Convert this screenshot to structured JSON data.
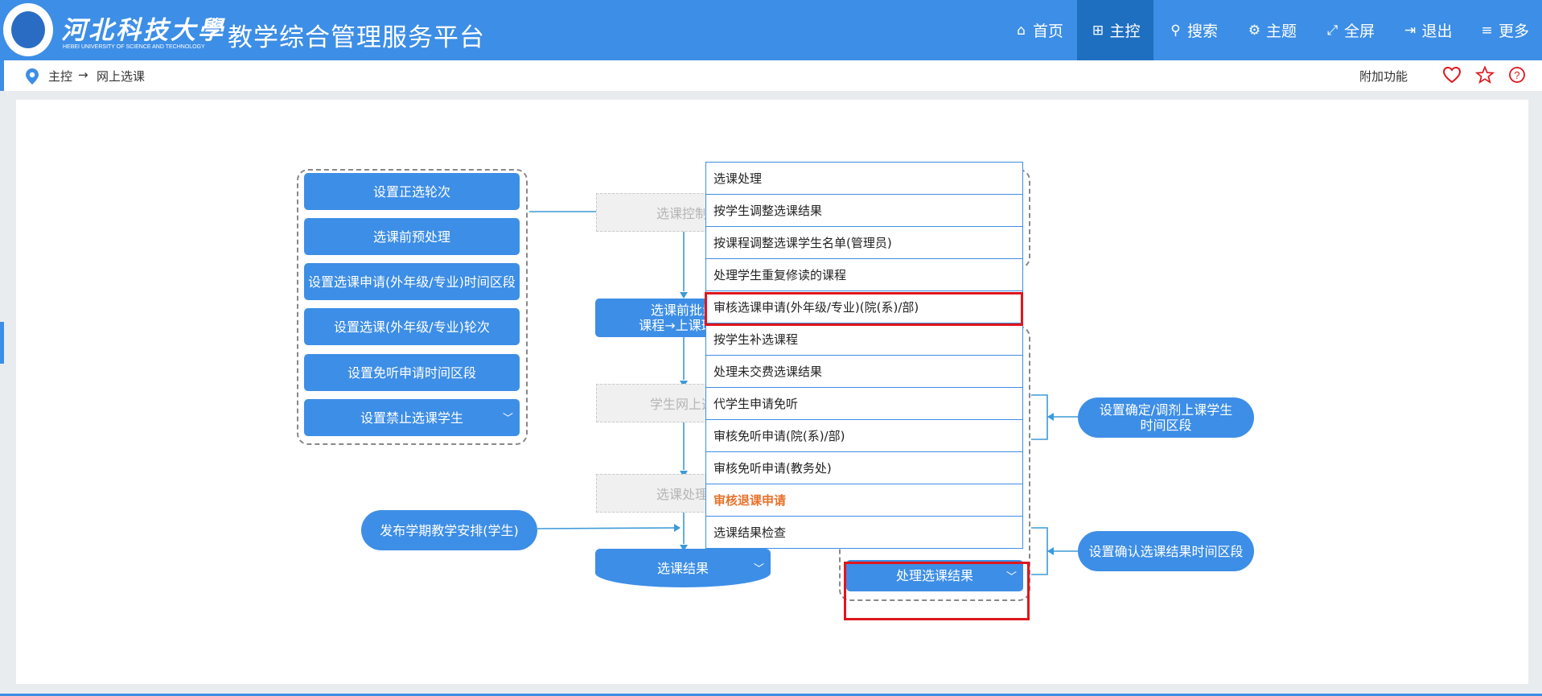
{
  "header": {
    "logo_cn": "河北科技大學",
    "logo_en": "HEBEI UNIVERSITY OF SCIENCE AND TECHNOLOGY",
    "title": "教学综合管理服务平台",
    "nav": [
      {
        "label": "首页",
        "icon": "home-icon"
      },
      {
        "label": "主控",
        "icon": "windows-icon",
        "active": true
      },
      {
        "label": "搜索",
        "icon": "search-icon"
      },
      {
        "label": "主题",
        "icon": "cogs-icon"
      },
      {
        "label": "全屏",
        "icon": "fullscreen-icon"
      },
      {
        "label": "退出",
        "icon": "exit-icon"
      },
      {
        "label": "更多",
        "icon": "list-icon"
      }
    ]
  },
  "breadcrumb": {
    "root": "主控",
    "arrow": "→",
    "current": "网上选课",
    "extra": "附加功能"
  },
  "flow": {
    "left_buttons": [
      "设置正选轮次",
      "选课前预处理",
      "设置选课申请(外年级/专业)时间区段",
      "设置选课(外年级/专业)轮次",
      "设置免听申请时间区段",
      "设置禁止选课学生"
    ],
    "ghost_control": "选课控制",
    "batch_line1": "选课前批量",
    "batch_line2": "课程→上课班级",
    "ghost_student": "学生网上选",
    "ghost_process": "选课处理",
    "publish_pill": "发布学期教学安排(学生)",
    "result_btn": "选课结果",
    "process_result_btn": "处理选课结果",
    "pill_adjust_line1": "设置确定/调剂上课学生",
    "pill_adjust_line2": "时间区段",
    "pill_confirm": "设置确认选课结果时间区段"
  },
  "dropdown": {
    "items": [
      "选课处理",
      "按学生调整选课结果",
      "按课程调整选课学生名单(管理员)",
      "处理学生重复修读的课程",
      "审核选课申请(外年级/专业)(院(系)/部)",
      "按学生补选课程",
      "处理未交费选课结果",
      "代学生申请免听",
      "审核免听申请(院(系)/部)",
      "审核免听申请(教务处)",
      "审核退课申请",
      "选课结果检查"
    ],
    "highlighted_item": "审核选课申请(外年级/专业)(院(系)/部)",
    "orange_item": "审核退课申请"
  },
  "colors": {
    "primary": "#3d8ee6",
    "active_nav": "#1f6fc0",
    "highlight_red": "#e0161c",
    "orange_text": "#e8712a"
  }
}
